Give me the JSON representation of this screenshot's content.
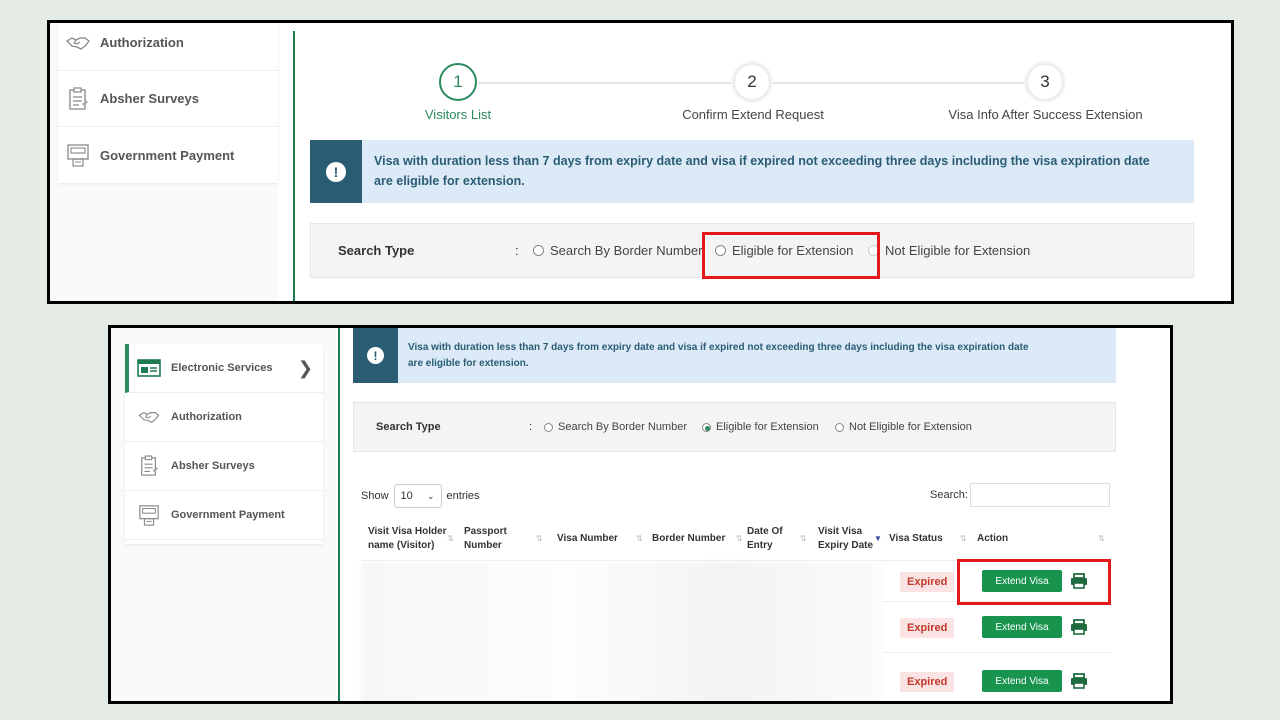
{
  "sidebar": {
    "items": [
      {
        "label": "Electronic Services",
        "icon": "grid-card-icon"
      },
      {
        "label": "Authorization",
        "icon": "handshake-icon"
      },
      {
        "label": "Absher Surveys",
        "icon": "survey-clipboard-icon"
      },
      {
        "label": "Government Payment",
        "icon": "payment-terminal-icon"
      }
    ]
  },
  "steps": [
    {
      "number": "1",
      "label": "Visitors List",
      "active": true
    },
    {
      "number": "2",
      "label": "Confirm Extend Request",
      "active": false
    },
    {
      "number": "3",
      "label": "Visa Info After Success Extension",
      "active": false
    }
  ],
  "alert": {
    "icon": "!",
    "line1": "Visa with duration less than 7 days from expiry date and visa if expired not exceeding three days including the visa expiration date",
    "line2": "are eligible for extension."
  },
  "search_type": {
    "label": "Search Type",
    "colon": ":",
    "options": [
      "Search By Border Number",
      "Eligible for Extension",
      "Not Eligible for Extension"
    ],
    "selected_top": "",
    "selected_bottom": "Eligible for Extension"
  },
  "table": {
    "show_label": "Show",
    "page_size": "10",
    "entries_label": "entries",
    "search_label": "Search:",
    "columns": [
      "Visit Visa Holder name (Visitor)",
      "Passport Number",
      "Visa Number",
      "Border Number",
      "Date Of Entry",
      "Visit Visa Expiry Date",
      "Visa Status",
      "Action"
    ],
    "rows": [
      {
        "status": "Expired",
        "action": "Extend Visa"
      },
      {
        "status": "Expired",
        "action": "Extend Visa"
      },
      {
        "status": "Expired",
        "action": "Extend Visa"
      }
    ]
  },
  "colors": {
    "accent": "#2b8a5e",
    "button": "#18944f",
    "alert_bg": "#dceaf8",
    "alert_icon_bg": "#2a5c74",
    "expired_text": "#c0392b",
    "highlight": "#e3191c"
  }
}
